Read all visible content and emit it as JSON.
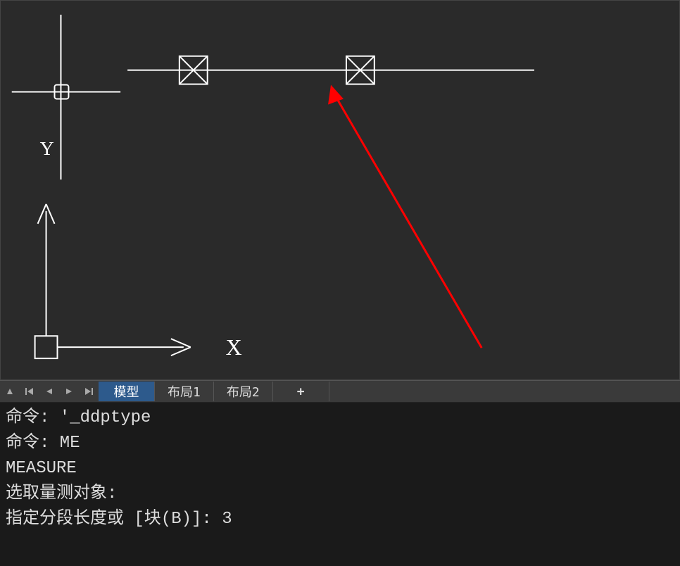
{
  "tabs": {
    "model": "模型",
    "layout1": "布局1",
    "layout2": "布局2",
    "add": "+"
  },
  "command_history": {
    "line1": "命令: '_ddptype",
    "line2": "命令: ME",
    "line3": "MEASURE",
    "line4": "选取量测对象:",
    "line5": "指定分段长度或 [块(B)]: 3"
  },
  "ucs_labels": {
    "y": "Y",
    "x": "X"
  }
}
